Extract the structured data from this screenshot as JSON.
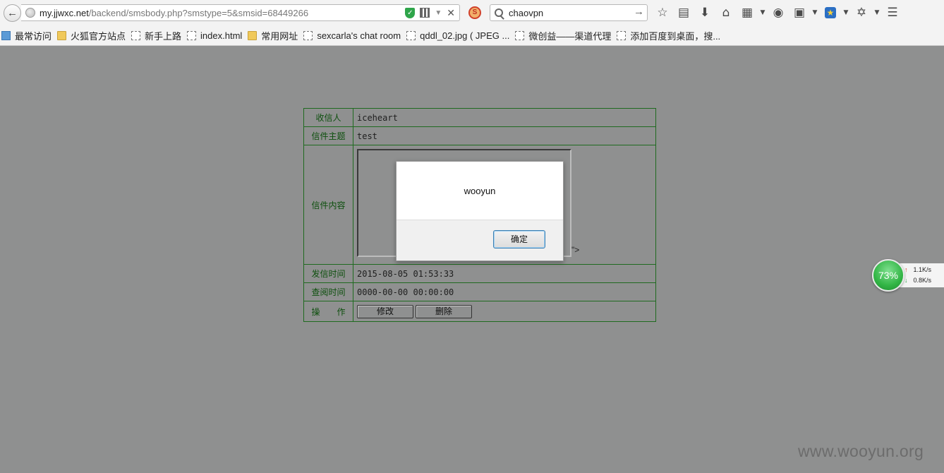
{
  "browser": {
    "url_host": "my.jjwxc.net",
    "url_path": "/backend/smsbody.php?smstype=5&smsid=68449266",
    "search_value": "chaovpn",
    "toolbar_icons": [
      "bookmark-star-icon",
      "reading-list-icon",
      "download-icon",
      "home-icon",
      "page-action-icon",
      "chat-icon",
      "crop-icon",
      "extension-star-icon",
      "addon-icon",
      "menu-icon"
    ]
  },
  "bookmarks": [
    {
      "label": "最常访问",
      "icon": "mv"
    },
    {
      "label": "火狐官方站点",
      "icon": "folder"
    },
    {
      "label": "新手上路",
      "icon": "page"
    },
    {
      "label": "index.html",
      "icon": "page"
    },
    {
      "label": "常用网址",
      "icon": "folder"
    },
    {
      "label": "sexcarla's chat room",
      "icon": "page"
    },
    {
      "label": "qddl_02.jpg ( JPEG ...",
      "icon": "page"
    },
    {
      "label": "微创益——渠道代理",
      "icon": "page"
    },
    {
      "label": "添加百度到桌面，搜...",
      "icon": "page"
    }
  ],
  "message": {
    "recipient_label": "收信人",
    "recipient": "iceheart",
    "subject_label": "信件主题",
    "subject": "test",
    "body_label": "信件内容",
    "body_tail": "\">",
    "sent_label": "发信时间",
    "sent_time": "2015-08-05 01:53:33",
    "read_label": "查阅时间",
    "read_time": "0000-00-00 00:00:00",
    "actions_label": "操　　作",
    "edit_button": "修改",
    "delete_button": "删除"
  },
  "alert": {
    "message": "wooyun",
    "ok_button": "确定"
  },
  "net_widget": {
    "percent": "73%",
    "upload": "1.1K/s",
    "download": "0.8K/s"
  },
  "watermark": "www.wooyun.org"
}
